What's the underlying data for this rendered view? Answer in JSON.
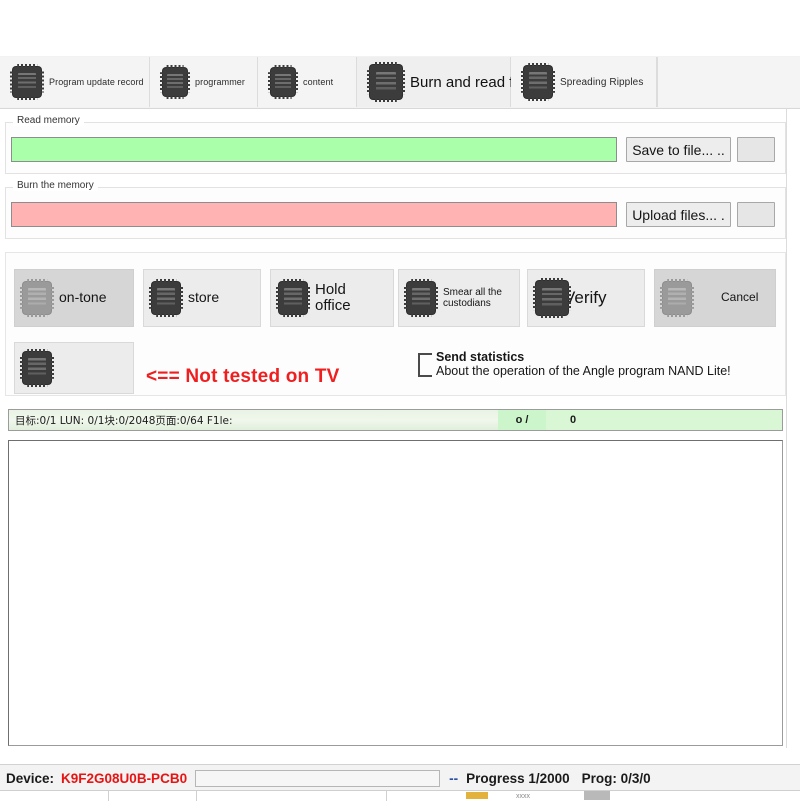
{
  "tabs": [
    {
      "label": "Program update record",
      "icon": "chip-icon",
      "selected": false,
      "size": "sm"
    },
    {
      "label": "programmer",
      "icon": "chip-icon",
      "selected": false,
      "size": "sm"
    },
    {
      "label": "content",
      "icon": "chip-icon",
      "selected": false,
      "size": "sm"
    },
    {
      "label": "Burn and read files",
      "icon": "chip-icon",
      "selected": true,
      "size": "lg"
    },
    {
      "label": "Spreading Ripples",
      "icon": "chip-icon",
      "selected": false,
      "size": "sm"
    }
  ],
  "read_memory": {
    "legend": "Read memory",
    "progress_color": "#aaffaa",
    "save_button": "Save to file... ..",
    "aux_button": ""
  },
  "burn_memory": {
    "legend": "Burn the memory",
    "progress_color": "#ffb3b3",
    "upload_button": "Upload files... .",
    "aux_button": ""
  },
  "actions": [
    {
      "label": "on-tone",
      "icon": "chip-icon"
    },
    {
      "label": "store",
      "icon": "chip-icon"
    },
    {
      "label": "Hold office",
      "icon": "chip-icon"
    },
    {
      "label": "Smear all the custodians",
      "icon": "chip-icon"
    },
    {
      "label": "Verify",
      "icon": "chip-icon"
    },
    {
      "label": "Cancel",
      "icon": "chip-icon"
    }
  ],
  "blank_action": {
    "label": "",
    "icon": "chip-icon"
  },
  "red_note": "<== Not tested on TV",
  "statistics": {
    "checked": false,
    "line1": "Send statistics",
    "line2": "About the operation of the Angle program NAND Lite!"
  },
  "target_status": {
    "text": "目标:0/1 LUN: 0/1块:0/2048页面:0/64 F1le:",
    "counter_a": "o /",
    "counter_b": "0"
  },
  "log": {
    "content": ""
  },
  "status_bar": {
    "device_label": "Device:",
    "device_value": "K9F2G08U0B-PCB0",
    "device_color": "#e81414",
    "field_value": "",
    "separator": "--",
    "progress": "Progress 1/2000",
    "prog": "Prog: 0/3/0"
  },
  "bottom_sliver": {
    "text": "xxxx"
  }
}
